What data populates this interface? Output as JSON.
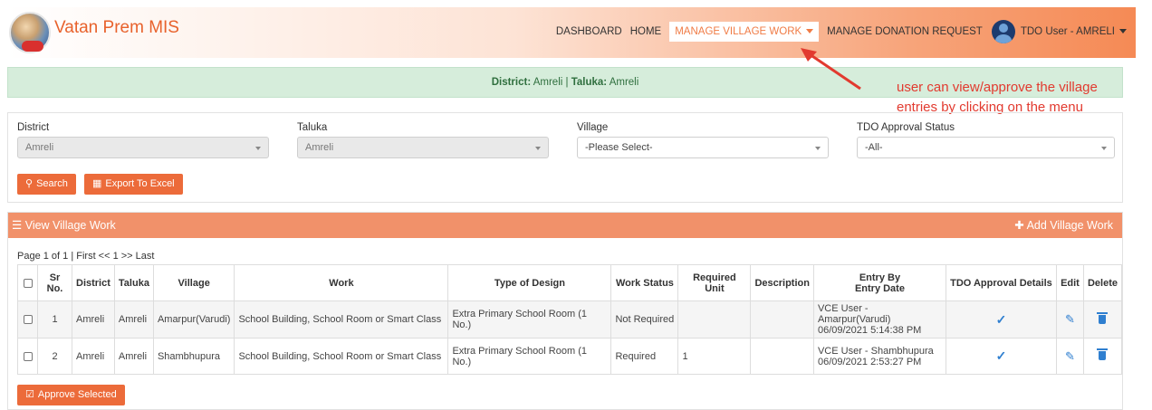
{
  "header": {
    "brand": "Vatan Prem MIS",
    "nav": [
      {
        "label": "DASHBOARD"
      },
      {
        "label": "HOME"
      },
      {
        "label": "MANAGE VILLAGE WORK"
      },
      {
        "label": "MANAGE DONATION REQUEST"
      }
    ],
    "user": "TDO User - AMRELI"
  },
  "banner": {
    "district_label": "District:",
    "district_value": "Amreli",
    "separator": "|",
    "taluka_label": "Taluka:",
    "taluka_value": "Amreli"
  },
  "annotation": {
    "line1": "user can view/approve the village",
    "line2": "entries by clicking on the menu"
  },
  "filters": {
    "district": {
      "label": "District",
      "value": "Amreli"
    },
    "taluka": {
      "label": "Taluka",
      "value": "Amreli"
    },
    "village": {
      "label": "Village",
      "value": "-Please Select-"
    },
    "tdo_status": {
      "label": "TDO Approval Status",
      "value": "-All-"
    },
    "search_label": "Search",
    "export_label": "Export To Excel"
  },
  "panel": {
    "title": "View Village Work",
    "add_label": "Add Village Work",
    "pager": "Page 1 of 1 |  First <<  1  >> Last"
  },
  "table": {
    "headers": {
      "sr": "Sr No.",
      "district": "District",
      "taluka": "Taluka",
      "village": "Village",
      "work": "Work",
      "design": "Type of Design",
      "status": "Work Status",
      "unit": "Required Unit",
      "description": "Description",
      "entry_by": "Entry By",
      "entry_date": "Entry Date",
      "tdo": "TDO Approval Details",
      "edit": "Edit",
      "delete": "Delete"
    },
    "rows": [
      {
        "sr": "1",
        "district": "Amreli",
        "taluka": "Amreli",
        "village": "Amarpur(Varudi)",
        "work": "School Building, School Room or Smart Class",
        "design": "Extra Primary School Room (1 No.)",
        "status": "Not Required",
        "unit": "",
        "description": "",
        "entry_by": "VCE User - Amarpur(Varudi)",
        "entry_date": "06/09/2021 5:14:38 PM"
      },
      {
        "sr": "2",
        "district": "Amreli",
        "taluka": "Amreli",
        "village": "Shambhupura",
        "work": "School Building, School Room or Smart Class",
        "design": "Extra Primary School Room (1 No.)",
        "status": "Required",
        "unit": "1",
        "description": "",
        "entry_by": "VCE User - Shambhupura",
        "entry_date": "06/09/2021 2:53:27 PM"
      }
    ]
  },
  "approve_label": "Approve Selected",
  "colors": {
    "accent": "#ec6b3a",
    "panel_header": "#f1916a",
    "banner_bg": "#d6eddb",
    "annotation": "#e23a2f",
    "icon_blue": "#2f7fd0"
  }
}
